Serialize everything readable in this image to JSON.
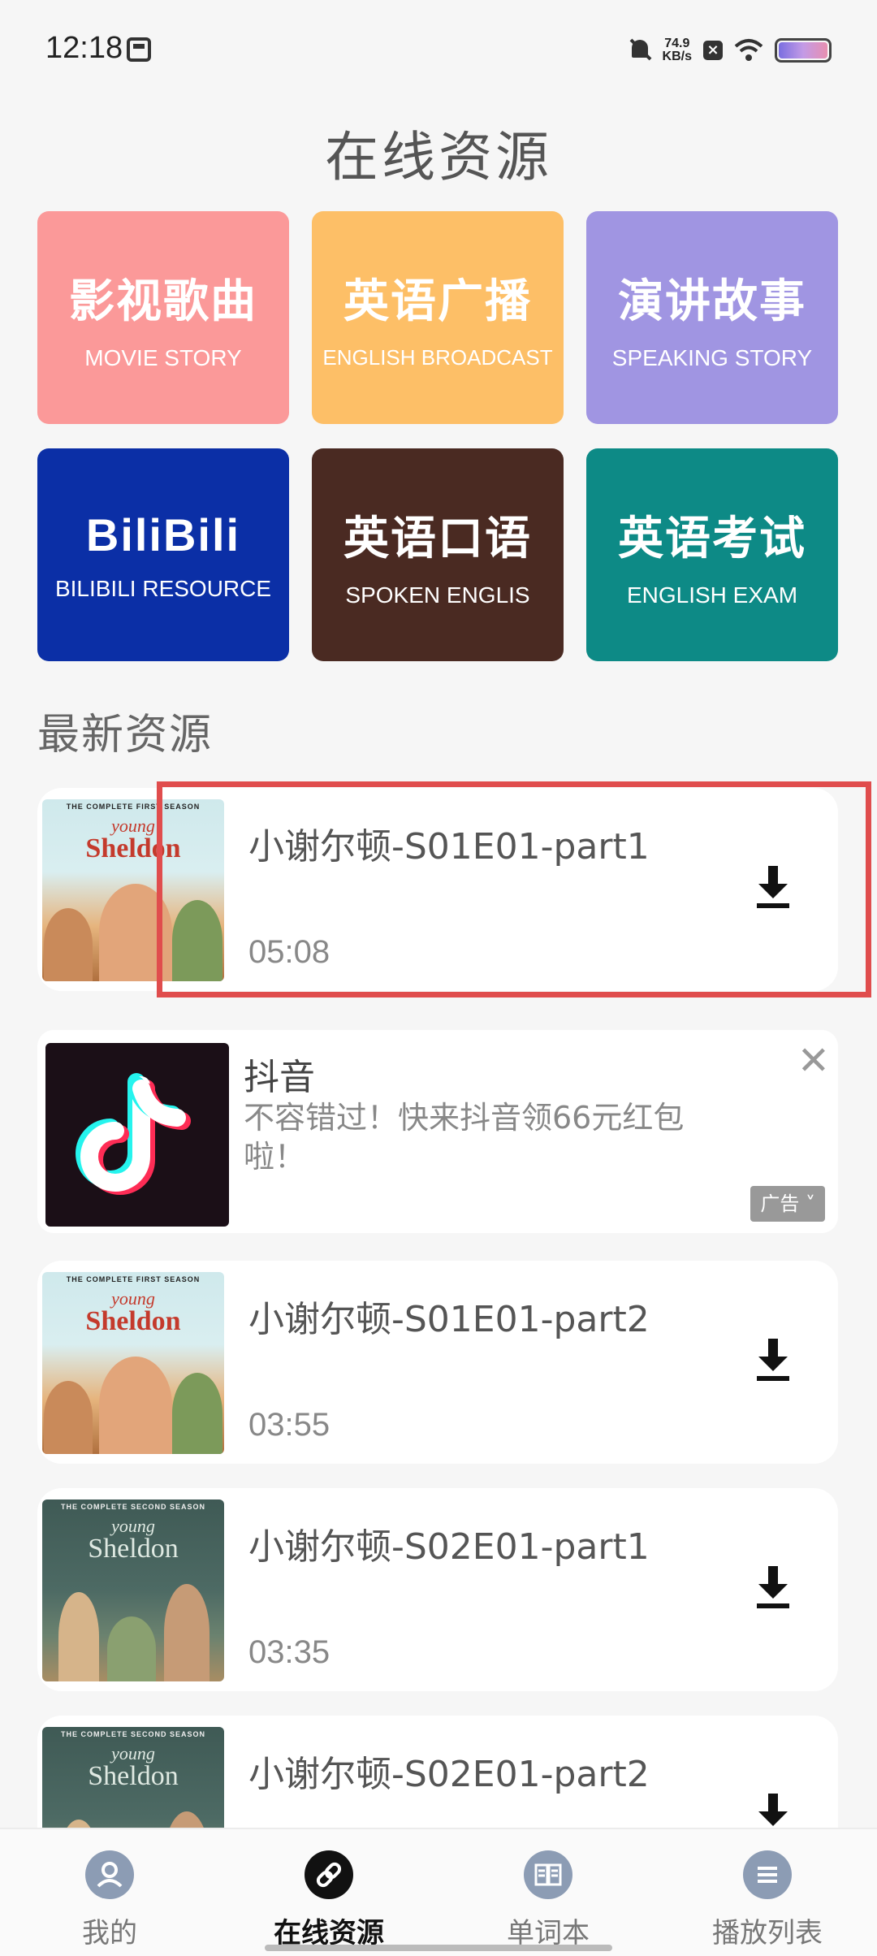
{
  "status_bar": {
    "time": "12:18",
    "net_speed_value": "74.9",
    "net_speed_unit": "KB/s"
  },
  "page": {
    "title": "在线资源"
  },
  "categories": [
    {
      "title": "影视歌曲",
      "subtitle": "MOVIE STORY",
      "color": "#fb9999"
    },
    {
      "title": "英语广播",
      "subtitle": "ENGLISH BROADCAST",
      "color": "#fdbf67"
    },
    {
      "title": "演讲故事",
      "subtitle": "SPEAKING STORY",
      "color": "#a095e2"
    },
    {
      "title": "BiliBili",
      "subtitle": "BILIBILI RESOURCE",
      "color": "#0b2fa6"
    },
    {
      "title": "英语口语",
      "subtitle": "SPOKEN ENGLIS",
      "color": "#4a2a22"
    },
    {
      "title": "英语考试",
      "subtitle": "ENGLISH EXAM",
      "color": "#0d8a86"
    }
  ],
  "latest": {
    "heading": "最新资源",
    "items": [
      {
        "title": "小谢尔顿-S01E01-part1",
        "duration": "05:08",
        "strap": "THE COMPLETE FIRST SEASON",
        "logo_top": "young",
        "logo_main": "Sheldon"
      },
      {
        "title": "小谢尔顿-S01E01-part2",
        "duration": "03:55",
        "strap": "THE COMPLETE FIRST SEASON",
        "logo_top": "young",
        "logo_main": "Sheldon"
      },
      {
        "title": "小谢尔顿-S02E01-part1",
        "duration": "03:35",
        "strap": "THE COMPLETE SECOND SEASON",
        "logo_top": "young",
        "logo_main": "Sheldon"
      },
      {
        "title": "小谢尔顿-S02E01-part2",
        "duration": "",
        "strap": "THE COMPLETE SECOND SEASON",
        "logo_top": "young",
        "logo_main": "Sheldon"
      }
    ]
  },
  "ad": {
    "title": "抖音",
    "text": "不容错过！快来抖音领66元红包啦！",
    "badge": "广告",
    "close_icon": "close-icon"
  },
  "bottom_nav": [
    {
      "label": "我的",
      "icon": "person-icon",
      "active": false
    },
    {
      "label": "在线资源",
      "icon": "link-icon",
      "active": true
    },
    {
      "label": "单词本",
      "icon": "book-icon",
      "active": false
    },
    {
      "label": "播放列表",
      "icon": "list-icon",
      "active": false
    }
  ],
  "colors": {
    "highlight": "#e04d4d",
    "nav_active": "#111111",
    "nav_inactive": "#8c9cb4"
  }
}
